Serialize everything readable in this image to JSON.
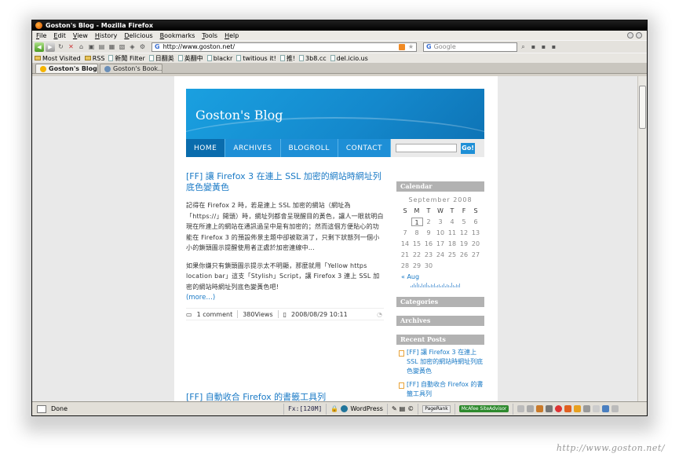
{
  "window": {
    "title": "Goston's Blog - Mozilla Firefox"
  },
  "menu": [
    "File",
    "Edit",
    "View",
    "History",
    "Delicious",
    "Bookmarks",
    "Tools",
    "Help"
  ],
  "toolbar": {
    "url": "http://www.goston.net/",
    "search_placeholder": "Google"
  },
  "bookmarks": [
    "Most Visited",
    "RSS",
    "新聞 Filter",
    "日翻英",
    "英翻中",
    "blackr",
    "twitious it!",
    "推!",
    "3b8.cc",
    "del.icio.us"
  ],
  "tabs": [
    {
      "label": "Goston's Blog"
    },
    {
      "label": "Goston's Book..."
    }
  ],
  "blog": {
    "title": "Goston's Blog",
    "nav": [
      "HOME",
      "ARCHIVES",
      "BLOGROLL",
      "CONTACT"
    ],
    "search_button": "Go!",
    "post1": {
      "title": "[FF] 讓 Firefox 3 在連上 SSL 加密的網站時網址列底色變黃色",
      "p1": "記得在 Firefox 2 時，若是連上 SSL 加密的網站（網址為「https://」開頭）時，網址列都會呈現醒目的黃色，讓人一眼就明白現在所連上的網站在通訊過呈中是有加密的；然而這個方便貼心的功能在 Firefox 3 的預設佈景主題中卻被取消了，只剩下狀態列一個小小的鎖頭圖示提醒使用者正處於加密連線中…",
      "p2": "如果你嫌只有鎖頭圖示提示太不明顯，那麼就用「Yellow https location bar」這支「Stylish」Script，讓 Firefox 3 連上 SSL 加密的網站時網址列底色變黃色吧!",
      "more": "(more…)",
      "comments": "1 comment",
      "views": "380Views",
      "date": "2008/08/29 10:11"
    },
    "post2": {
      "title": "[FF] 自動收合 Firefox 的書籤工具列"
    },
    "sidebar": {
      "calendar_title": "Calendar",
      "month": "September 2008",
      "weekdays": [
        "S",
        "M",
        "T",
        "W",
        "T",
        "F",
        "S"
      ],
      "days": [
        "",
        "1",
        "2",
        "3",
        "4",
        "5",
        "6",
        "7",
        "8",
        "9",
        "10",
        "11",
        "12",
        "13",
        "14",
        "15",
        "16",
        "17",
        "18",
        "19",
        "20",
        "21",
        "22",
        "23",
        "24",
        "25",
        "26",
        "27",
        "28",
        "29",
        "30",
        "",
        "",
        "",
        ""
      ],
      "prev": "« Aug",
      "categories": "Categories",
      "archives": "Archives",
      "recent_title": "Recent Posts",
      "recent": [
        "[FF] 讓 Firefox 3 在連上 SSL 加密的網站時網址列底色變黃色",
        "[FF] 自動收合 Firefox 的書籤工具列"
      ]
    }
  },
  "status": {
    "text": "Done",
    "fx": "Fx:[120M]",
    "wordpress": "WordPress",
    "pagerank": "PageRank",
    "mcafee": "McAfee SiteAdvisor"
  },
  "watermark": "http://www.goston.net/"
}
